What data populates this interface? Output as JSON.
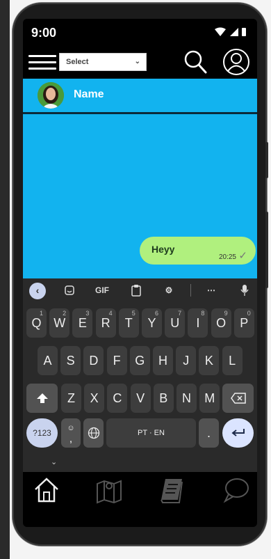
{
  "status_bar": {
    "time": "9:00",
    "icons": [
      "wifi-icon",
      "signal-icon",
      "battery-icon"
    ]
  },
  "header": {
    "menu_icon": "hamburger-icon",
    "select": {
      "value": "Select"
    },
    "search_icon": "search-icon",
    "profile_icon": "user-icon"
  },
  "contact": {
    "name": "Name",
    "avatar_icon": "avatar"
  },
  "messages": [
    {
      "text": "Heyy",
      "time": "20:25",
      "status": "sent",
      "status_icon": "check-icon"
    }
  ],
  "keyboard": {
    "toolbar": {
      "items": [
        {
          "name": "back-arrow-icon"
        },
        {
          "name": "sticker-icon"
        },
        {
          "name": "gif-button",
          "label": "GIF"
        },
        {
          "name": "clipboard-icon"
        },
        {
          "name": "settings-icon"
        },
        {
          "name": "more-icon"
        },
        {
          "name": "mic-icon"
        }
      ]
    },
    "rows": [
      [
        {
          "label": "Q",
          "sub": "1"
        },
        {
          "label": "W",
          "sub": "2"
        },
        {
          "label": "E",
          "sub": "3"
        },
        {
          "label": "R",
          "sub": "4"
        },
        {
          "label": "T",
          "sub": "5"
        },
        {
          "label": "Y",
          "sub": "6"
        },
        {
          "label": "U",
          "sub": "7"
        },
        {
          "label": "I",
          "sub": "8"
        },
        {
          "label": "O",
          "sub": "9"
        },
        {
          "label": "P",
          "sub": "0"
        }
      ],
      [
        {
          "label": "A"
        },
        {
          "label": "S"
        },
        {
          "label": "D"
        },
        {
          "label": "F"
        },
        {
          "label": "G"
        },
        {
          "label": "H"
        },
        {
          "label": "J"
        },
        {
          "label": "K"
        },
        {
          "label": "L"
        }
      ],
      [
        {
          "label": "Z"
        },
        {
          "label": "X"
        },
        {
          "label": "C"
        },
        {
          "label": "V"
        },
        {
          "label": "B"
        },
        {
          "label": "N"
        },
        {
          "label": "M"
        }
      ]
    ],
    "symbols_label": "?123",
    "space_label": "PT · EN",
    "period_label": ".",
    "comma_label": ",",
    "shift_icon": "shift-icon",
    "backspace_icon": "backspace-icon",
    "enter_icon": "enter-icon",
    "emoji_icon": "emoji-icon",
    "globe_icon": "globe-icon",
    "hide_icon": "chevron-down-icon"
  },
  "bottom_nav": [
    {
      "name": "nav-home",
      "icon": "home-icon"
    },
    {
      "name": "nav-map",
      "icon": "map-icon"
    },
    {
      "name": "nav-book",
      "icon": "book-icon"
    },
    {
      "name": "nav-chat",
      "icon": "chat-icon"
    }
  ],
  "colors": {
    "accent": "#12b3ef",
    "bubble": "#b0f07e",
    "keyboard": "#2a2a2a",
    "key": "#3d3d3d",
    "enter": "#dbe4ff"
  }
}
